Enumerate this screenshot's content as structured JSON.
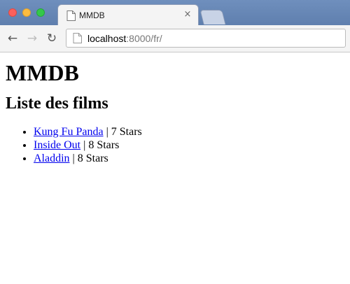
{
  "window": {
    "tab_title": "MMDB",
    "tab_close": "×",
    "icons": [
      "close-window-icon",
      "minimize-window-icon",
      "maximize-window-icon",
      "page-icon",
      "close-tab-icon",
      "back-arrow-icon",
      "forward-arrow-icon",
      "reload-icon"
    ]
  },
  "address_bar": {
    "host": "localhost",
    "path": ":8000/fr/"
  },
  "page": {
    "title": "MMDB",
    "subtitle": "Liste des films",
    "films": [
      {
        "name": "Kung Fu Panda",
        "rating": " | 7 Stars"
      },
      {
        "name": "Inside Out",
        "rating": " | 8 Stars"
      },
      {
        "name": "Aladdin",
        "rating": " | 8 Stars"
      }
    ]
  }
}
